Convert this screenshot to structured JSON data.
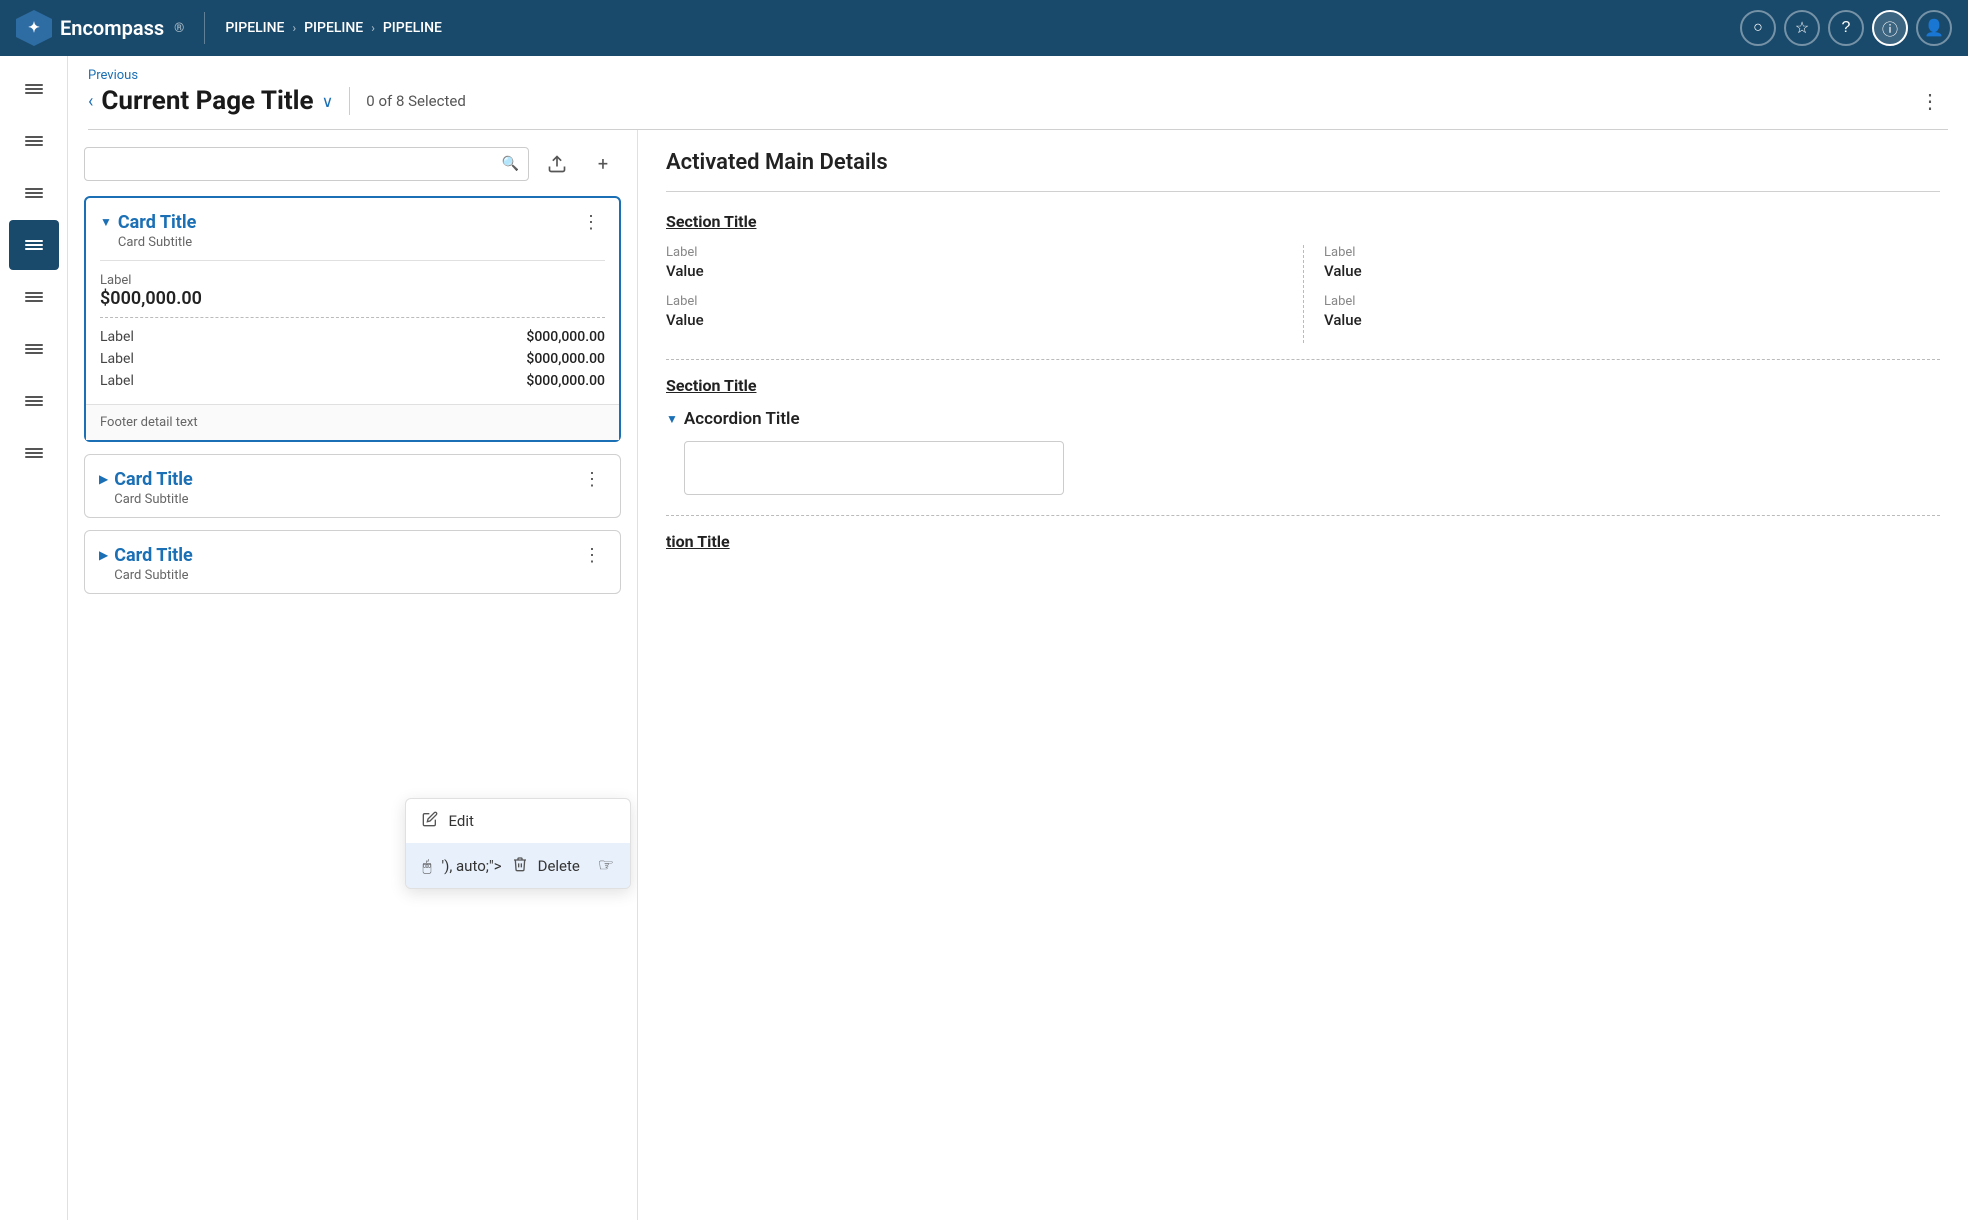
{
  "topNav": {
    "logo": "Encompass",
    "breadcrumbs": [
      "PIPELINE",
      "PIPELINE",
      "PIPELINE"
    ],
    "icons": [
      "circle",
      "star",
      "question",
      "info",
      "user"
    ]
  },
  "sidebar": {
    "items": [
      {
        "id": "item1",
        "label": "list-icon-1"
      },
      {
        "id": "item2",
        "label": "list-icon-2"
      },
      {
        "id": "item3",
        "label": "list-icon-3"
      },
      {
        "id": "item4",
        "label": "list-icon-4",
        "active": true
      },
      {
        "id": "item5",
        "label": "list-icon-5"
      },
      {
        "id": "item6",
        "label": "list-icon-6"
      },
      {
        "id": "item7",
        "label": "list-icon-7"
      },
      {
        "id": "item8",
        "label": "list-icon-8"
      }
    ]
  },
  "pageHeader": {
    "back_label": "Previous",
    "title": "Current Page Title",
    "selection_count": "0",
    "selection_total": "8",
    "selected_label": "Selected"
  },
  "leftPanel": {
    "search_placeholder": "",
    "cards": [
      {
        "id": "card1",
        "title": "Card Title",
        "subtitle": "Card Subtitle",
        "selected": true,
        "expanded": true,
        "main_label": "Label",
        "main_value": "$000,000.00",
        "rows": [
          {
            "label": "Label",
            "value": "$000,000.00"
          },
          {
            "label": "Label",
            "value": "$000,000.00"
          },
          {
            "label": "Label",
            "value": "$000,000.00"
          }
        ],
        "footer": "Footer detail text"
      },
      {
        "id": "card2",
        "title": "Card Title",
        "subtitle": "Card Subtitle",
        "selected": false,
        "expanded": false
      },
      {
        "id": "card3",
        "title": "Card Title",
        "subtitle": "Card Subtitle",
        "selected": false,
        "expanded": false
      }
    ],
    "contextMenu": {
      "items": [
        {
          "id": "edit",
          "label": "Edit",
          "icon": "edit"
        },
        {
          "id": "delete",
          "label": "Delete",
          "icon": "delete",
          "active": true
        }
      ]
    }
  },
  "rightPanel": {
    "title": "Activated Main Details",
    "sections": [
      {
        "id": "section1",
        "title": "Section Title",
        "cols": [
          {
            "fields": [
              {
                "label": "Label",
                "value": "Value"
              },
              {
                "label": "Label",
                "value": "Value"
              }
            ]
          },
          {
            "fields": [
              {
                "label": "Label",
                "value": "Value"
              },
              {
                "label": "Label",
                "value": "Value"
              }
            ]
          }
        ]
      },
      {
        "id": "section2",
        "title": "Section Title",
        "accordion_title": "Accordion Title",
        "accordion_expanded": true
      },
      {
        "id": "section3",
        "title": "tion Title"
      }
    ]
  }
}
